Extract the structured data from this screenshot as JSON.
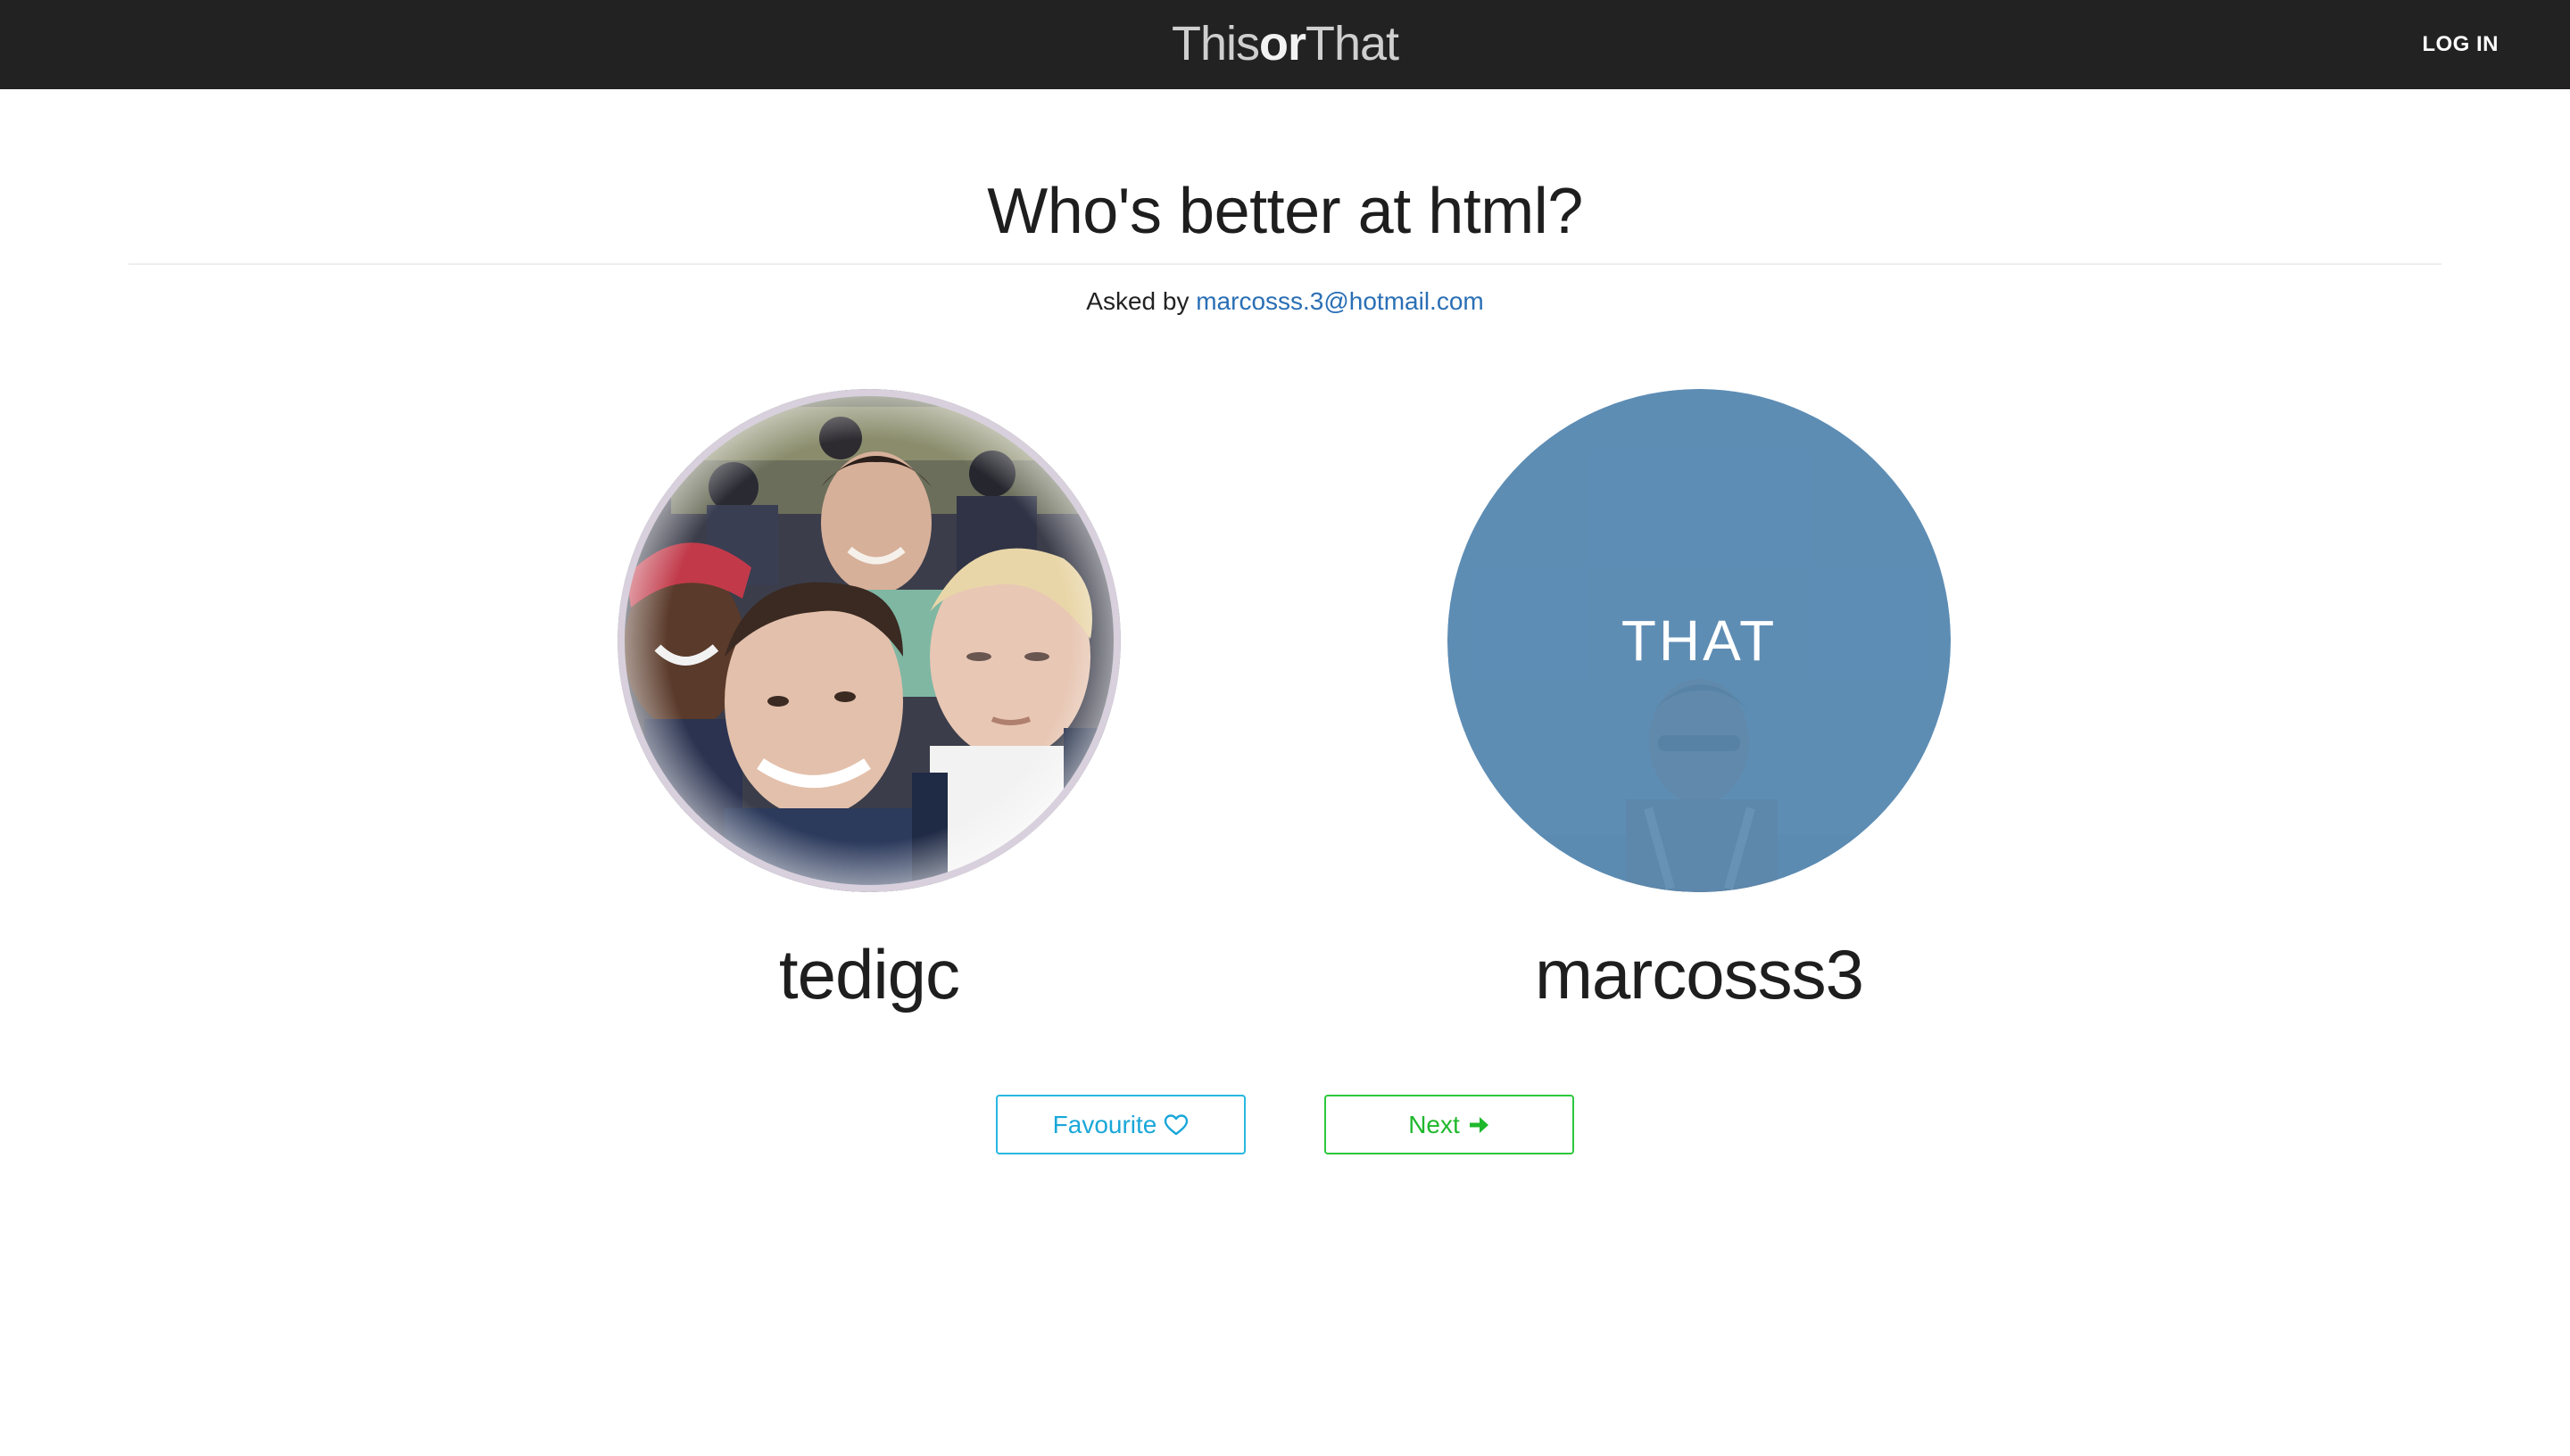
{
  "navbar": {
    "brand_this": "This",
    "brand_or": "or",
    "brand_that": "That",
    "login_label": "LOG IN"
  },
  "question": {
    "title": "Who's better at html?",
    "asked_prefix": "Asked by",
    "asker_email": "marcosss.3@hotmail.com"
  },
  "choices": [
    {
      "name": "tedigc",
      "image": "group-selfie-photo"
    },
    {
      "name": "marcosss3",
      "overlay_label": "THAT",
      "image": "person-photo"
    }
  ],
  "actions": {
    "favourite_label": "Favourite",
    "favourite_icon": "heart-outline-icon",
    "next_label": "Next",
    "next_icon": "arrow-right-icon"
  },
  "colors": {
    "navbar_bg": "#222222",
    "link": "#2a6fb5",
    "favourite": "#28b7e0",
    "next": "#2dc83c",
    "that_overlay": "#5c8bb2"
  }
}
